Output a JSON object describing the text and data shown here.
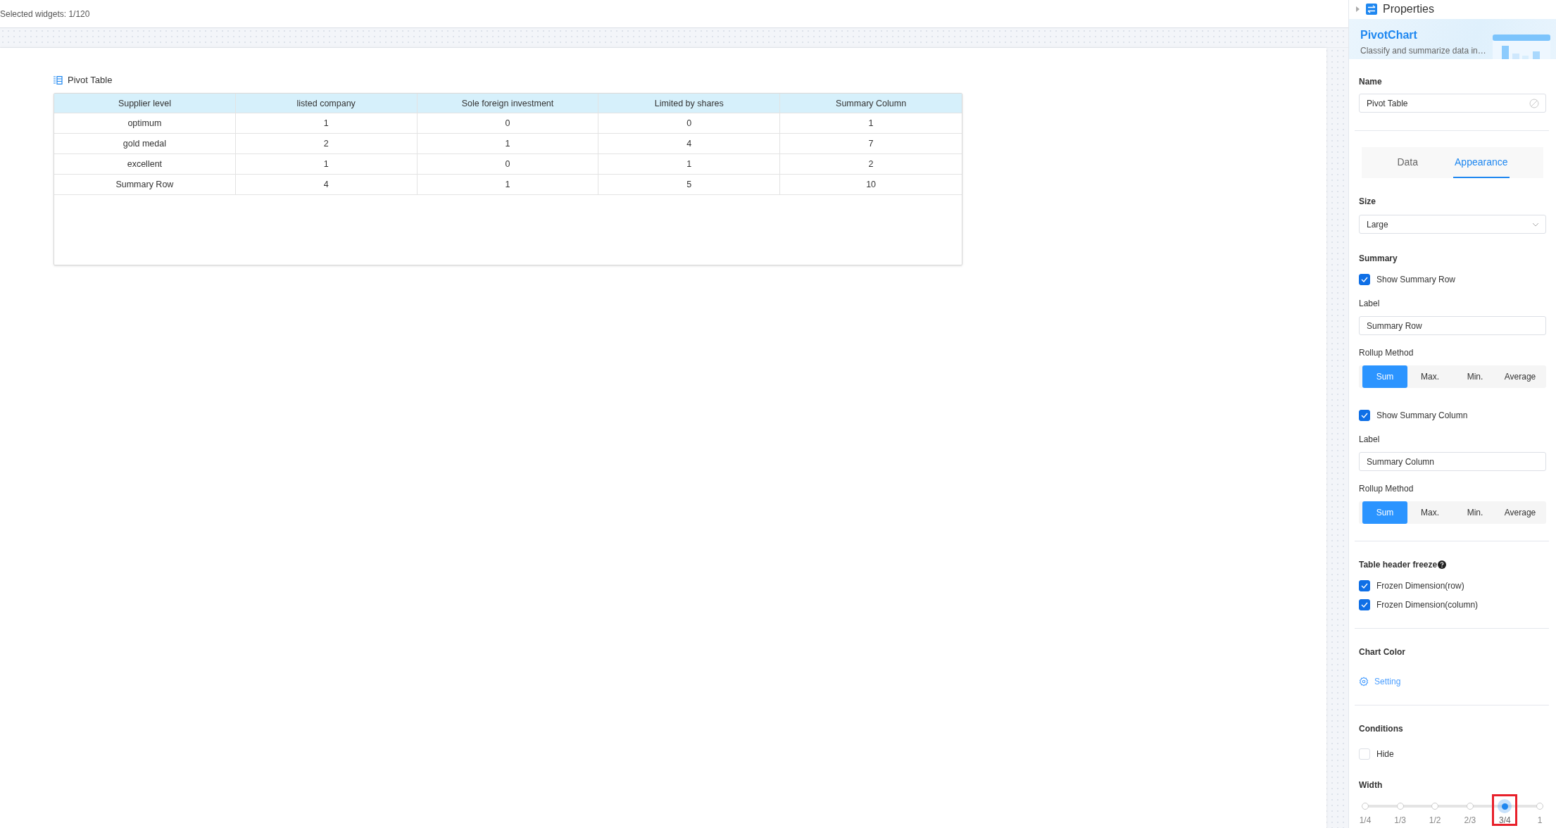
{
  "top_bar": {
    "status": "Selected widgets: 1/120"
  },
  "widget": {
    "title": "Pivot Table",
    "table": {
      "columns": [
        "Supplier level",
        "listed company",
        "Sole foreign investment",
        "Limited by shares",
        "Summary Column"
      ],
      "rows": [
        [
          "optimum",
          "1",
          "0",
          "0",
          "1"
        ],
        [
          "gold medal",
          "2",
          "1",
          "4",
          "7"
        ],
        [
          "excellent",
          "1",
          "0",
          "1",
          "2"
        ],
        [
          "Summary Row",
          "4",
          "1",
          "5",
          "10"
        ]
      ]
    }
  },
  "properties": {
    "title": "Properties",
    "expanded": false,
    "banner": {
      "title": "PivotChart",
      "description": "Classify and summarize data in…"
    },
    "name": {
      "label": "Name",
      "value": "Pivot Table"
    },
    "tabs": [
      {
        "label": "Data",
        "selected": false
      },
      {
        "label": "Appearance",
        "selected": true
      }
    ],
    "size": {
      "label": "Size",
      "value": "Large"
    },
    "summary": {
      "title": "Summary",
      "groups": [
        {
          "toggle": {
            "label": "Show Summary Row",
            "checked": true
          },
          "label_title": "Label",
          "label_value": "Summary Row",
          "method_title": "Rollup Method",
          "methods": [
            {
              "label": "Sum",
              "selected": true
            },
            {
              "label": "Max.",
              "selected": false
            },
            {
              "label": "Min.",
              "selected": false
            },
            {
              "label": "Average",
              "selected": false
            }
          ]
        },
        {
          "toggle": {
            "label": "Show Summary Column",
            "checked": true
          },
          "label_title": "Label",
          "label_value": "Summary Column",
          "method_title": "Rollup Method",
          "methods": [
            {
              "label": "Sum",
              "selected": true
            },
            {
              "label": "Max.",
              "selected": false
            },
            {
              "label": "Min.",
              "selected": false
            },
            {
              "label": "Average",
              "selected": false
            }
          ]
        }
      ]
    },
    "freeze": {
      "title": "Table header freeze",
      "options": [
        {
          "label": "Frozen Dimension(row)",
          "checked": true
        },
        {
          "label": "Frozen Dimension(column)",
          "checked": true
        }
      ]
    },
    "chart_color": {
      "title": "Chart Color",
      "link": "Setting"
    },
    "conditions": {
      "title": "Conditions",
      "options": [
        {
          "label": "Hide",
          "checked": false
        }
      ]
    },
    "width": {
      "title": "Width",
      "level": 0.8,
      "highlight_selected": true,
      "marks": [
        {
          "label": "1/4",
          "selected": false
        },
        {
          "label": "1/3",
          "selected": false
        },
        {
          "label": "1/2",
          "selected": false
        },
        {
          "label": "2/3",
          "selected": false
        },
        {
          "label": "3/4",
          "selected": true
        },
        {
          "label": "1",
          "selected": false
        }
      ]
    }
  }
}
